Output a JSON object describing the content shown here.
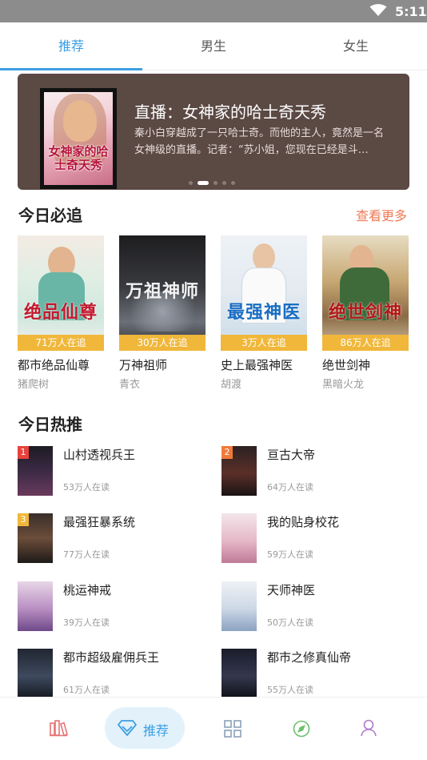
{
  "status_bar": {
    "time": "5:11"
  },
  "tabs": [
    {
      "label": "推荐"
    },
    {
      "label": "男生"
    },
    {
      "label": "女生"
    }
  ],
  "banner": {
    "cover_text": "女神家的哈士奇天秀",
    "title": "直播：女神家的哈士奇天秀",
    "description": "秦小白穿越成了一只哈士奇。而他的主人，竟然是一名女神级的直播。记者：“苏小姐，您现在已经是斗…"
  },
  "must_read": {
    "title": "今日必追",
    "more": "查看更多",
    "books": [
      {
        "cover_text": "绝品仙尊",
        "badge": "71万人在追",
        "title": "都市绝品仙尊",
        "author": "猪爬树"
      },
      {
        "cover_text": "万祖神师",
        "badge": "30万人在追",
        "title": "万神祖师",
        "author": "青衣"
      },
      {
        "cover_text": "最强神医",
        "badge": "3万人在追",
        "title": "史上最强神医",
        "author": "胡渡"
      },
      {
        "cover_text": "绝世剑神",
        "badge": "86万人在追",
        "title": "绝世剑神",
        "author": "黑暗火龙"
      }
    ]
  },
  "hot": {
    "title": "今日热推",
    "items": [
      {
        "rank": "1",
        "title": "山村透视兵王",
        "readers": "53万人在读"
      },
      {
        "rank": "2",
        "title": "亘古大帝",
        "readers": "64万人在读"
      },
      {
        "rank": "3",
        "title": "最强狂暴系统",
        "readers": "77万人在读"
      },
      {
        "rank": "",
        "title": "我的贴身校花",
        "readers": "59万人在读"
      },
      {
        "rank": "",
        "title": "桃运神戒",
        "readers": "39万人在读"
      },
      {
        "rank": "",
        "title": "天师神医",
        "readers": "50万人在读"
      },
      {
        "rank": "",
        "title": "都市超级雇佣兵王",
        "readers": "61万人在读"
      },
      {
        "rank": "",
        "title": "都市之修真仙帝",
        "readers": "55万人在读"
      }
    ]
  },
  "bottom_nav": {
    "items": [
      {
        "icon": "bookshelf-icon"
      },
      {
        "icon": "gem-icon",
        "label": "推荐"
      },
      {
        "icon": "grid-icon"
      },
      {
        "icon": "compass-icon"
      },
      {
        "icon": "user-icon"
      }
    ]
  },
  "colors": {
    "accent": "#3b9fe3",
    "more_link": "#f07a55",
    "badge": "#f0b73a",
    "rank1": "#e8423c",
    "rank2": "#f07a3a",
    "rank3": "#f0b73a"
  }
}
